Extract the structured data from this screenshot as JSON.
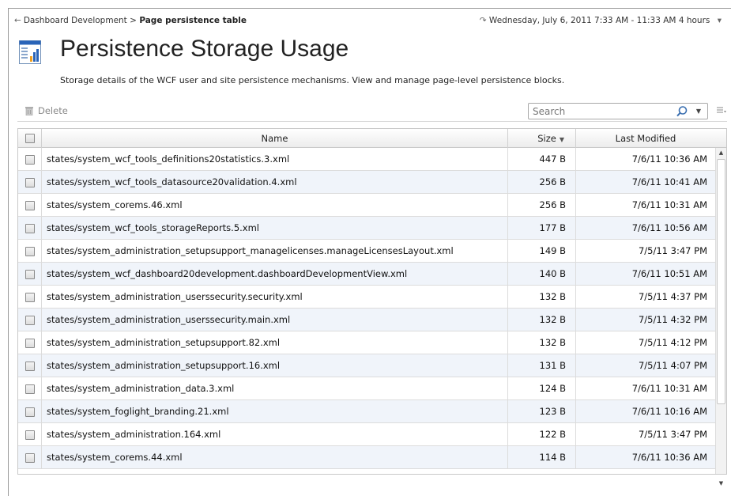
{
  "breadcrumb": {
    "parent": "Dashboard Development",
    "separator": ">",
    "current": "Page persistence table"
  },
  "timerange": {
    "label": "Wednesday, July 6, 2011 7:33 AM - 11:33 AM 4 hours"
  },
  "page": {
    "title": "Persistence Storage Usage",
    "description": "Storage details of the WCF user and site persistence mechanisms. View and manage page-level persistence blocks."
  },
  "toolbar": {
    "delete_label": "Delete",
    "search_placeholder": "Search"
  },
  "table": {
    "columns": {
      "name": "Name",
      "size": "Size",
      "modified": "Last Modified"
    },
    "rows": [
      {
        "name": "states/system_wcf_tools_definitions20statistics.3.xml",
        "size": "447 B",
        "modified": "7/6/11 10:36 AM"
      },
      {
        "name": "states/system_wcf_tools_datasource20validation.4.xml",
        "size": "256 B",
        "modified": "7/6/11 10:41 AM"
      },
      {
        "name": "states/system_corems.46.xml",
        "size": "256 B",
        "modified": "7/6/11 10:31 AM"
      },
      {
        "name": "states/system_wcf_tools_storageReports.5.xml",
        "size": "177 B",
        "modified": "7/6/11 10:56 AM"
      },
      {
        "name": "states/system_administration_setupsupport_managelicenses.manageLicensesLayout.xml",
        "size": "149 B",
        "modified": "7/5/11 3:47 PM"
      },
      {
        "name": "states/system_wcf_dashboard20development.dashboardDevelopmentView.xml",
        "size": "140 B",
        "modified": "7/6/11 10:51 AM"
      },
      {
        "name": "states/system_administration_userssecurity.security.xml",
        "size": "132 B",
        "modified": "7/5/11 4:37 PM"
      },
      {
        "name": "states/system_administration_userssecurity.main.xml",
        "size": "132 B",
        "modified": "7/5/11 4:32 PM"
      },
      {
        "name": "states/system_administration_setupsupport.82.xml",
        "size": "132 B",
        "modified": "7/5/11 4:12 PM"
      },
      {
        "name": "states/system_administration_setupsupport.16.xml",
        "size": "131 B",
        "modified": "7/5/11 4:07 PM"
      },
      {
        "name": "states/system_administration_data.3.xml",
        "size": "124 B",
        "modified": "7/6/11 10:31 AM"
      },
      {
        "name": "states/system_foglight_branding.21.xml",
        "size": "123 B",
        "modified": "7/6/11 10:16 AM"
      },
      {
        "name": "states/system_administration.164.xml",
        "size": "122 B",
        "modified": "7/5/11 3:47 PM"
      },
      {
        "name": "states/system_corems.44.xml",
        "size": "114 B",
        "modified": "7/6/11 10:36 AM"
      }
    ]
  },
  "colors": {
    "row_alt": "#f0f4fa",
    "icon_blue": "#2a64b8",
    "icon_orange": "#f0a020"
  },
  "icons": [
    "back-icon",
    "chevron-down-icon",
    "storage-chart-icon",
    "trash-icon",
    "search-icon",
    "column-menu-icon",
    "sort-desc-icon"
  ]
}
